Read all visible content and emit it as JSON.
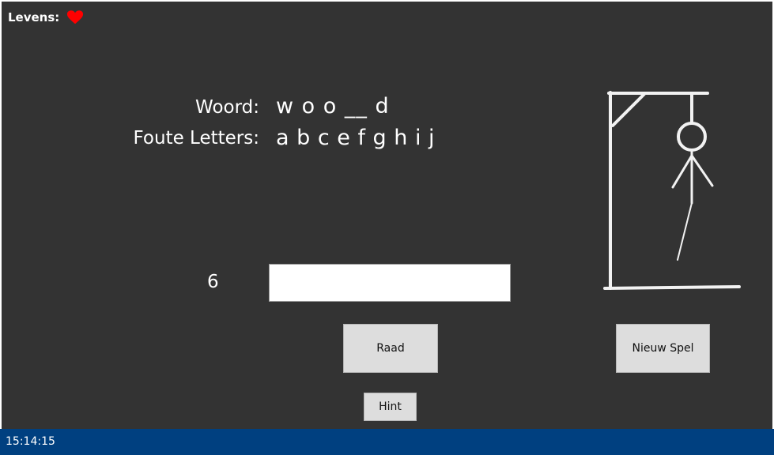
{
  "header": {
    "lives_label": "Levens:",
    "lives_icon": "heart-icon",
    "lives_color": "#ff0000"
  },
  "game": {
    "word_label": "Woord:",
    "word_value": "w o o __ d",
    "wrong_label": "Foute Letters:",
    "wrong_value": "a b c e f g h i j",
    "remaining": "6",
    "guess_input": ""
  },
  "buttons": {
    "guess": "Raad",
    "new_game": "Nieuw Spel",
    "hint": "Hint"
  },
  "statusbar": {
    "time": "15:14:15",
    "color": "#004080"
  },
  "colors": {
    "background": "#333333",
    "chalk": "#ffffff"
  }
}
